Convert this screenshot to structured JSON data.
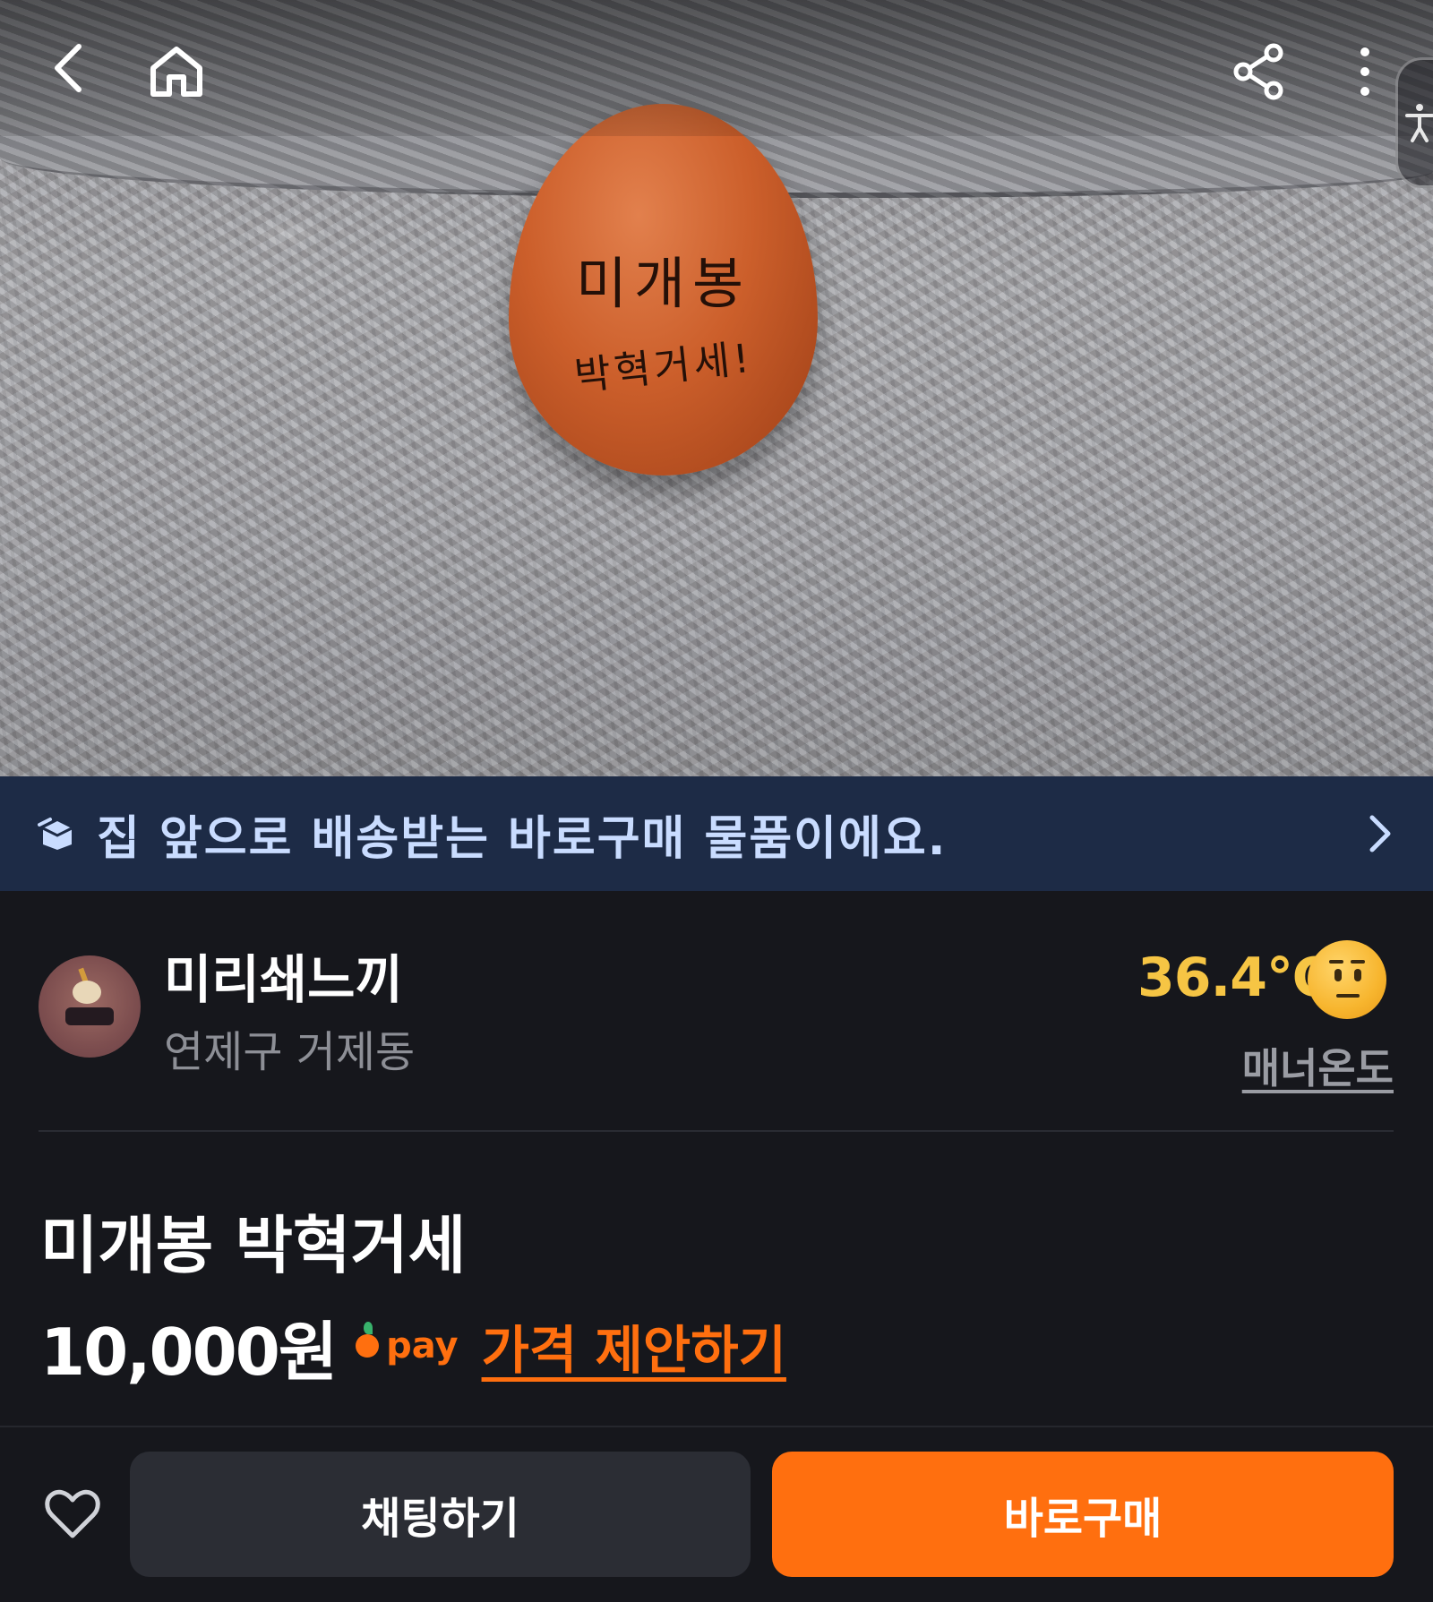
{
  "hero": {
    "egg_line1": "미개봉",
    "egg_line2": "박혁거세!"
  },
  "topbar": {
    "back_icon": "chevron-left-icon",
    "home_icon": "home-icon",
    "share_icon": "share-icon",
    "more_icon": "more-vertical-icon",
    "accessibility_icon": "accessibility-icon"
  },
  "banner": {
    "icon": "delivery-box-icon",
    "text": "집 앞으로 배송받는 바로구매 물품이에요.",
    "chevron_icon": "chevron-right-icon"
  },
  "seller": {
    "name": "미리쇄느끼",
    "location": "연제구 거제동",
    "temperature": "36.4℃",
    "temperature_face_icon": "neutral-face-icon",
    "manner_label": "매너온도"
  },
  "product": {
    "title": "미개봉 박혁거세",
    "price": "10,000원",
    "pay_label": "pay",
    "offer_label": "가격 제안하기"
  },
  "bottom_bar": {
    "heart_icon": "heart-outline-icon",
    "chat_label": "채팅하기",
    "buy_label": "바로구매"
  },
  "colors": {
    "background": "#16171c",
    "banner_bg": "#1d2b46",
    "banner_text": "#c9dcff",
    "accent_orange": "#ff6f0f",
    "temperature_yellow": "#f6c544",
    "secondary_text": "#8d8f96",
    "chat_button_bg": "#2b2d34"
  }
}
